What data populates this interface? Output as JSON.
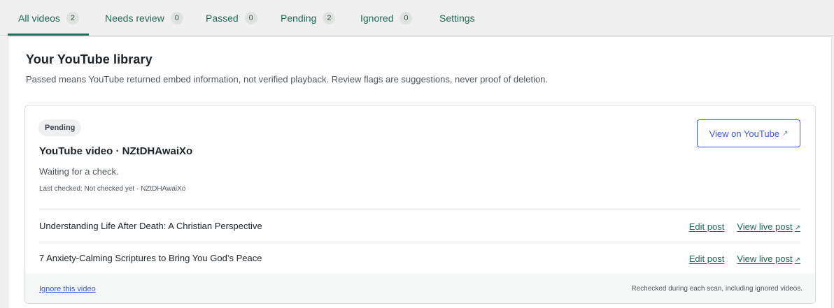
{
  "tabs": [
    {
      "label": "All videos",
      "count": "2"
    },
    {
      "label": "Needs review",
      "count": "0"
    },
    {
      "label": "Passed",
      "count": "0"
    },
    {
      "label": "Pending",
      "count": "2"
    },
    {
      "label": "Ignored",
      "count": "0"
    },
    {
      "label": "Settings"
    }
  ],
  "library": {
    "title": "Your YouTube library",
    "description": "Passed means YouTube returned embed information, not verified playback. Review flags are suggestions, never proof of deletion."
  },
  "video": {
    "status_badge": "Pending",
    "title": "YouTube video · NZtDHAwaiXo",
    "status_text": "Waiting for a check.",
    "meta": "Last checked: Not checked yet · NZtDHAwaiXo",
    "view_button": "View on YouTube",
    "view_button_icon": "↗",
    "posts": [
      {
        "title": "Understanding Life After Death: A Christian Perspective",
        "edit": "Edit post",
        "live": "View live post",
        "live_icon": "↗"
      },
      {
        "title": "7 Anxiety-Calming Scriptures to Bring You God’s Peace",
        "edit": "Edit post",
        "live": "View live post",
        "live_icon": "↗"
      }
    ],
    "footer": {
      "ignore_link": "Ignore this video",
      "note": "Rechecked during each scan, including ignored videos."
    }
  },
  "colors": {
    "accent": "#1e6b55",
    "link_blue": "#3858e9",
    "background": "#f0f0f1"
  }
}
